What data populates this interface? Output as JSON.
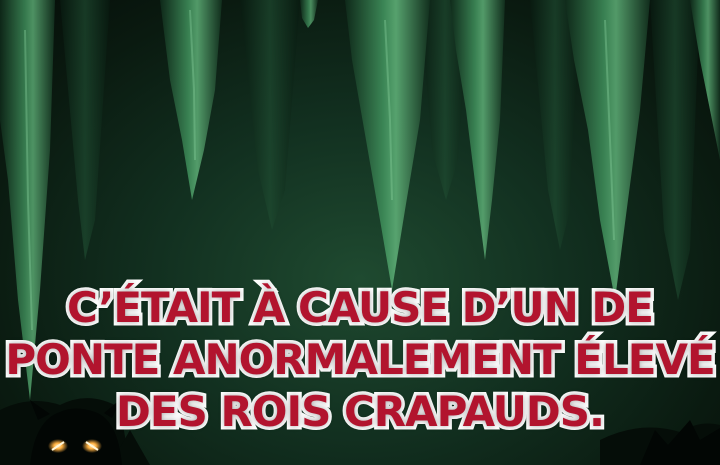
{
  "caption": {
    "lines": [
      "C’ÉTAIT À CAUSE D’UN DE",
      "PONTE ANORMALEMENT ÉLEVÉ",
      "DES ROIS CRAPAUDS."
    ]
  },
  "scene": {
    "background": "cave-stalactites",
    "colors": {
      "glow": "#2f7a4a",
      "dark": "#050d08",
      "text_fill": "#b2142e",
      "text_outline": "#ffffff",
      "eyes": "#ffb040"
    }
  }
}
